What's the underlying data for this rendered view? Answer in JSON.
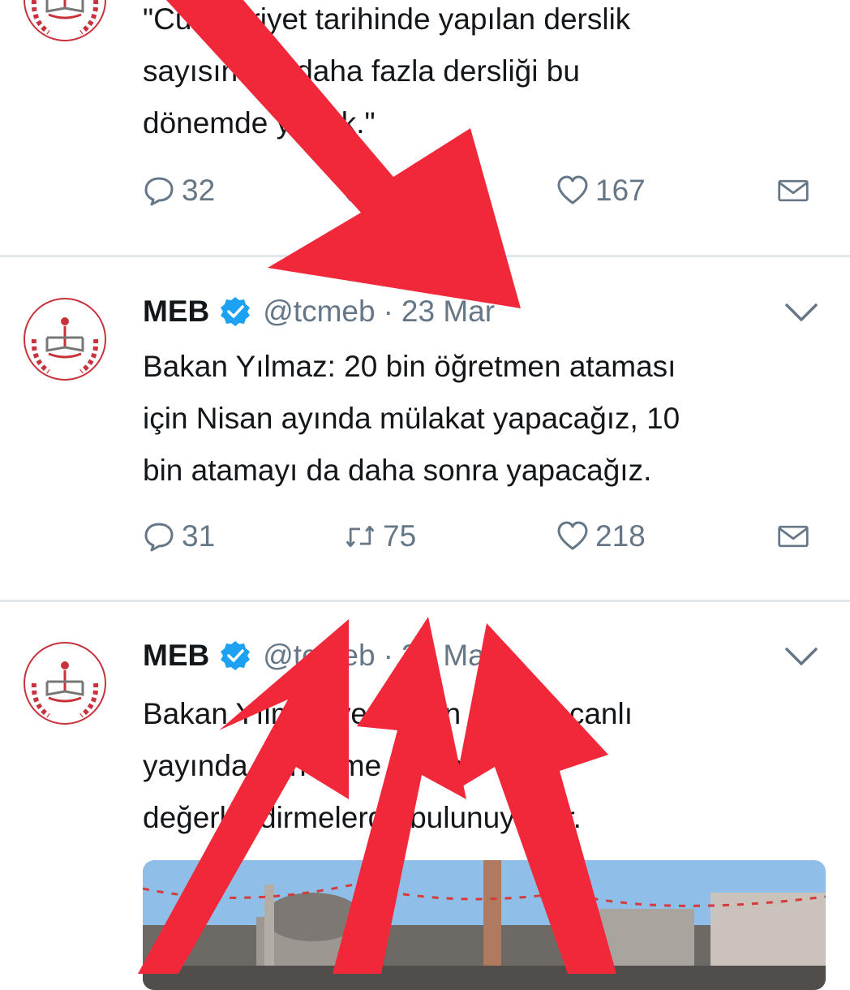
{
  "tweets": [
    {
      "text_lines": [
        "\"Cumhuriyet tarihinde yapılan derslik",
        "sayısından daha fazla dersliği bu",
        "dönemde yaptık.\""
      ],
      "replies": "32",
      "likes": "167"
    },
    {
      "name": "MEB",
      "handle": "@tcmeb",
      "separator": "·",
      "date": "23 Mar",
      "text_lines": [
        "Bakan Yılmaz: 20 bin öğretmen ataması",
        "için Nisan ayında mülakat yapacağız, 10",
        "bin atamayı da daha sonra yapacağız."
      ],
      "replies": "31",
      "retweets": "75",
      "likes": "218"
    },
    {
      "name": "MEB",
      "handle": "@tcmeb",
      "separator": "·",
      "date": "23 Mar",
      "text_lines": [
        "Bakan Yılmaz ve Bakan Arslan, canlı",
        "yayında gündeme ilişkin",
        "değerlendirmelerde bulunuyorlar."
      ]
    }
  ],
  "icons": {
    "avatar": "meb-logo-icon",
    "verified": "verified-badge-icon",
    "reply": "reply-icon",
    "retweet": "retweet-icon",
    "like": "heart-icon",
    "dm": "envelope-icon",
    "menu": "chevron-down-icon"
  },
  "colors": {
    "verified": "#1da1f2",
    "arrow": "#f1283a",
    "muted": "#657786",
    "divider": "#e1e8ed"
  }
}
